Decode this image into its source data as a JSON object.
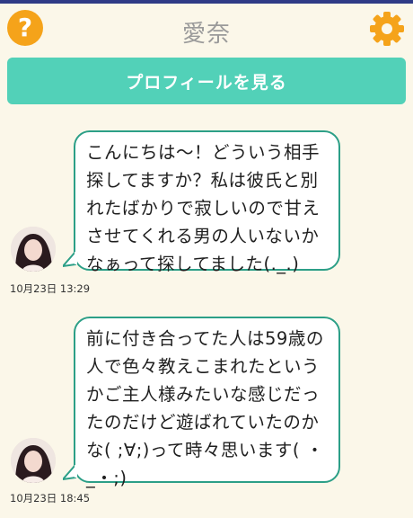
{
  "header": {
    "title": "愛奈",
    "help_icon": "question-icon",
    "settings_icon": "gear-icon",
    "accent_color": "#f5a31a"
  },
  "profile_button": {
    "label": "プロフィールを見る",
    "color": "#52d1b8"
  },
  "messages": [
    {
      "text": "こんにちは〜！どういう相手探してますか？私は彼氏と別れたばかりで寂しいので甘えさせてくれる男の人いないかなぁって探してました(._.)",
      "timestamp": "10月23日 13:29"
    },
    {
      "text": "前に付き合ってた人は59歳の人で色々教えこまれたというかご主人様みたいな感じだったのだけど遊ばれていたのかな( ;∀;)って時々思います( ・_・;)",
      "timestamp": "10月23日 18:45"
    }
  ]
}
